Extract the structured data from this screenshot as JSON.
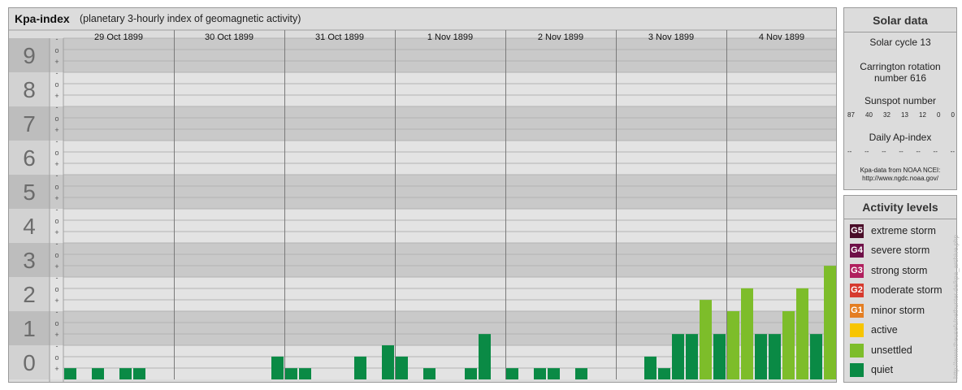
{
  "header": {
    "title": "Kpa-index",
    "subtitle": "(planetary 3-hourly index of geomagnetic activity)"
  },
  "solar": {
    "title": "Solar data",
    "cycle": "Solar cycle 13",
    "carrington_line1": "Carrington rotation",
    "carrington_line2": "number 616",
    "sunspot_label": "Sunspot number",
    "sunspot_values": [
      "87",
      "40",
      "32",
      "13",
      "12",
      "0",
      "0"
    ],
    "ap_label": "Daily Ap-index",
    "ap_values": [
      "--",
      "--",
      "--",
      "--",
      "--",
      "--",
      "--"
    ],
    "source_line1": "Kpa-data from NOAA NCEI:",
    "source_line2": "http://www.ngdc.noaa.gov/"
  },
  "activity": {
    "title": "Activity levels",
    "levels": [
      {
        "badge": "G5",
        "label": "extreme storm",
        "color": "#4a0d29"
      },
      {
        "badge": "G4",
        "label": "severe storm",
        "color": "#6e1048"
      },
      {
        "badge": "G3",
        "label": "strong storm",
        "color": "#b0205e"
      },
      {
        "badge": "G2",
        "label": "moderate storm",
        "color": "#d63a2e"
      },
      {
        "badge": "G1",
        "label": "minor storm",
        "color": "#e47e22"
      },
      {
        "badge": "",
        "label": "active",
        "color": "#f7c500"
      },
      {
        "badge": "",
        "label": "unsettled",
        "color": "#7dbd2a"
      },
      {
        "badge": "",
        "label": "quiet",
        "color": "#0a8a45"
      }
    ]
  },
  "watermark": "http://www.theusefulnethunter.de/kpa_archive.php",
  "chart_data": {
    "type": "bar",
    "title": "Kpa-index",
    "subtitle": "(planetary 3-hourly index of geomagnetic activity)",
    "ylim": [
      0,
      9
    ],
    "y_ticks": [
      "0",
      "1",
      "2",
      "3",
      "4",
      "5",
      "6",
      "7",
      "8",
      "9"
    ],
    "y_subticks": [
      "+",
      "o",
      "-"
    ],
    "days": [
      "29 Oct 1899",
      "30 Oct 1899",
      "31 Oct 1899",
      "1 Nov 1899",
      "2 Nov 1899",
      "3 Nov 1899",
      "4 Nov 1899"
    ],
    "interval_start_labels": [
      "0",
      "3",
      "6",
      "9",
      "12",
      "15",
      "18",
      "21"
    ],
    "interval_end_labels": [
      "3",
      "6",
      "9",
      "12",
      "15",
      "18",
      "21",
      "24"
    ],
    "series": [
      {
        "day": "29 Oct 1899",
        "values": [
          0.33,
          0,
          0.33,
          0,
          0.33,
          0.33,
          0,
          0
        ]
      },
      {
        "day": "30 Oct 1899",
        "values": [
          0,
          0,
          0,
          0,
          0,
          0,
          0,
          0.67
        ]
      },
      {
        "day": "31 Oct 1899",
        "values": [
          0.33,
          0.33,
          0,
          0,
          0,
          0.67,
          0,
          1.0
        ]
      },
      {
        "day": "1 Nov 1899",
        "values": [
          0.67,
          0,
          0.33,
          0,
          0,
          0.33,
          1.33,
          0
        ]
      },
      {
        "day": "2 Nov 1899",
        "values": [
          0.33,
          0,
          0.33,
          0.33,
          0,
          0.33,
          0,
          0
        ]
      },
      {
        "day": "3 Nov 1899",
        "values": [
          0,
          0,
          0.67,
          0.33,
          1.33,
          1.33,
          2.33,
          1.33
        ]
      },
      {
        "day": "4 Nov 1899",
        "values": [
          2.0,
          2.67,
          1.33,
          1.33,
          2.0,
          2.67,
          1.33,
          3.33
        ]
      }
    ],
    "colors": {
      "quiet": "#0a8a45",
      "unsettled": "#7dbd2a"
    },
    "grid": true
  }
}
